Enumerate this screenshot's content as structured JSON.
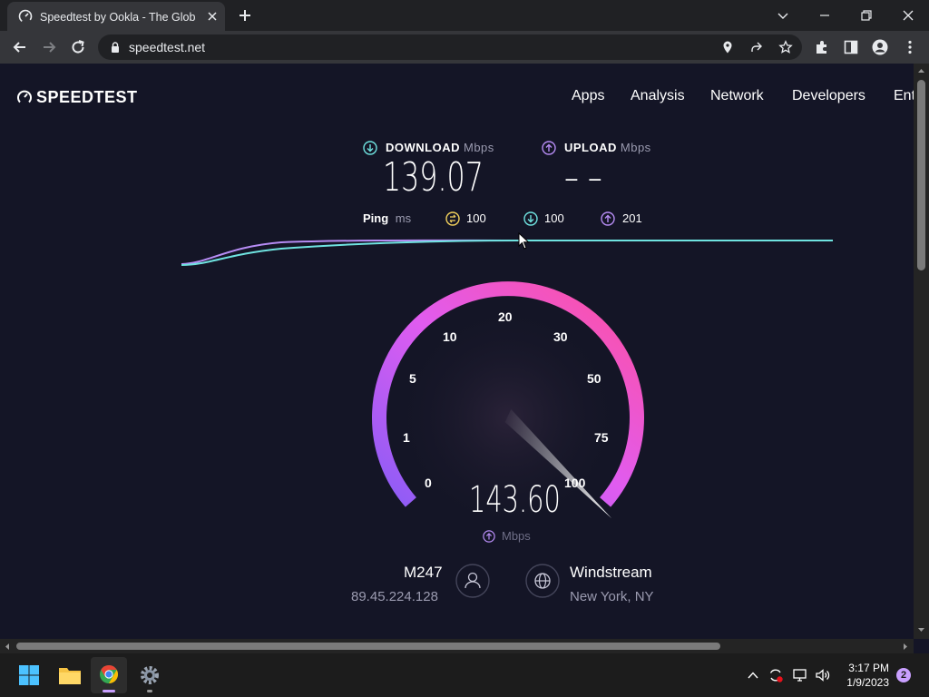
{
  "browser": {
    "tab_title": "Speedtest by Ookla - The Global Broadband Speed Test",
    "url": "speedtest.net"
  },
  "site": {
    "logo": "SPEEDTEST",
    "nav": [
      "Apps",
      "Analysis",
      "Network",
      "Developers",
      "Ent"
    ]
  },
  "test": {
    "download_label": "DOWNLOAD",
    "upload_label": "UPLOAD",
    "unit": "Mbps",
    "download_value": "139.07",
    "upload_value": "– –",
    "ping_label": "Ping",
    "ping_unit": "ms",
    "ping_idle": "100",
    "ping_down": "100",
    "ping_up": "201",
    "gauge_value": "143.60",
    "gauge_unit": "Mbps",
    "gauge_ticks": [
      "0",
      "1",
      "5",
      "10",
      "20",
      "30",
      "50",
      "75",
      "100"
    ]
  },
  "client": {
    "name": "M247",
    "ip": "89.45.224.128"
  },
  "server": {
    "isp": "Windstream",
    "location": "New York, NY"
  },
  "taskbar": {
    "time": "3:17 PM",
    "date": "1/9/2023",
    "notifications": "2"
  },
  "colors": {
    "page_bg": "#141526",
    "download_accent": "#6fe3e0",
    "upload_accent": "#b68cf4",
    "gauge_start": "#8a5cf6",
    "gauge_end": "#ff4fa0"
  }
}
